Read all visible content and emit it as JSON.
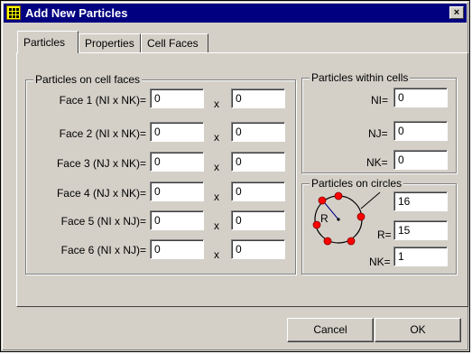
{
  "window": {
    "title": "Add New Particles",
    "close_glyph": "×"
  },
  "tabs": [
    {
      "label": "Particles",
      "active": true
    },
    {
      "label": "Properties",
      "active": false
    },
    {
      "label": "Cell Faces",
      "active": false
    }
  ],
  "faces_group": {
    "label": "Particles on cell faces",
    "multiply": "x",
    "rows": [
      {
        "label": "Face 1 (NI x NK)=",
        "a": "0",
        "b": "0"
      },
      {
        "label": "Face 2 (NI x NK)=",
        "a": "0",
        "b": "0"
      },
      {
        "label": "Face 3 (NJ x NK)=",
        "a": "0",
        "b": "0"
      },
      {
        "label": "Face 4 (NJ x NK)=",
        "a": "0",
        "b": "0"
      },
      {
        "label": "Face 5 (NI x NJ)=",
        "a": "0",
        "b": "0"
      },
      {
        "label": "Face 6 (NI x NJ)=",
        "a": "0",
        "b": "0"
      }
    ]
  },
  "within_group": {
    "label": "Particles within cells",
    "ni_label": "NI=",
    "ni_value": "0",
    "nj_label": "NJ=",
    "nj_value": "0",
    "nk_label": "NK=",
    "nk_value": "0"
  },
  "circles_group": {
    "label": "Particles on circles",
    "count_value": "16",
    "r_label": "R=",
    "r_value": "15",
    "nk_label": "NK=",
    "nk_value": "1",
    "diagram_r_label": "R"
  },
  "colors": {
    "particle": "#ff0000",
    "title_bar": "#000080",
    "face": "#d4d0c8"
  },
  "buttons": {
    "cancel": "Cancel",
    "ok": "OK"
  }
}
